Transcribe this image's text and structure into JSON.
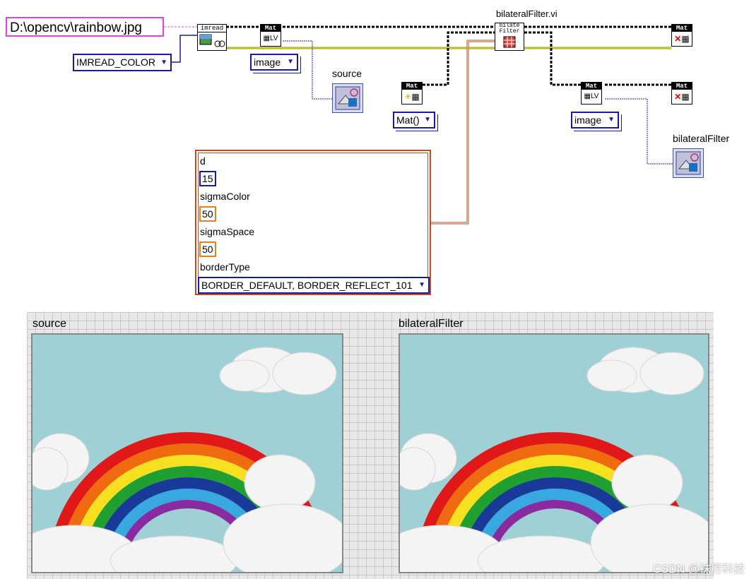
{
  "path_constant": "D:\\opencv\\rainbow.jpg",
  "imread_flag": "IMREAD_COLOR",
  "nodes": {
    "imread_title": "imread",
    "mat_title": "Mat",
    "lv_label": "LV",
    "bilateral_title": "bilate Filter",
    "bilateral_vi_label": "bilateralFilter.vi"
  },
  "dropdowns": {
    "image_1": "image",
    "mat_ctor": "Mat()",
    "image_2": "image"
  },
  "indicators": {
    "source": "source",
    "bilateral": "bilateralFilter"
  },
  "cluster": {
    "d_label": "d",
    "d_value": "15",
    "sigma_color_label": "sigmaColor",
    "sigma_color_value": "50",
    "sigma_space_label": "sigmaSpace",
    "sigma_space_value": "50",
    "border_type_label": "borderType",
    "border_type_value": "BORDER_DEFAULT, BORDER_REFLECT_101"
  },
  "front_panel": {
    "source_title": "source",
    "bilateral_title": "bilateralFilter"
  },
  "watermark": "CSDN @袜厉科技",
  "colors": {
    "wire_mat": "#000000",
    "wire_enum": "#1a1aa0",
    "wire_cluster": "#b05020",
    "wire_path": "#e040e0",
    "sky": "#9fd0d6"
  }
}
